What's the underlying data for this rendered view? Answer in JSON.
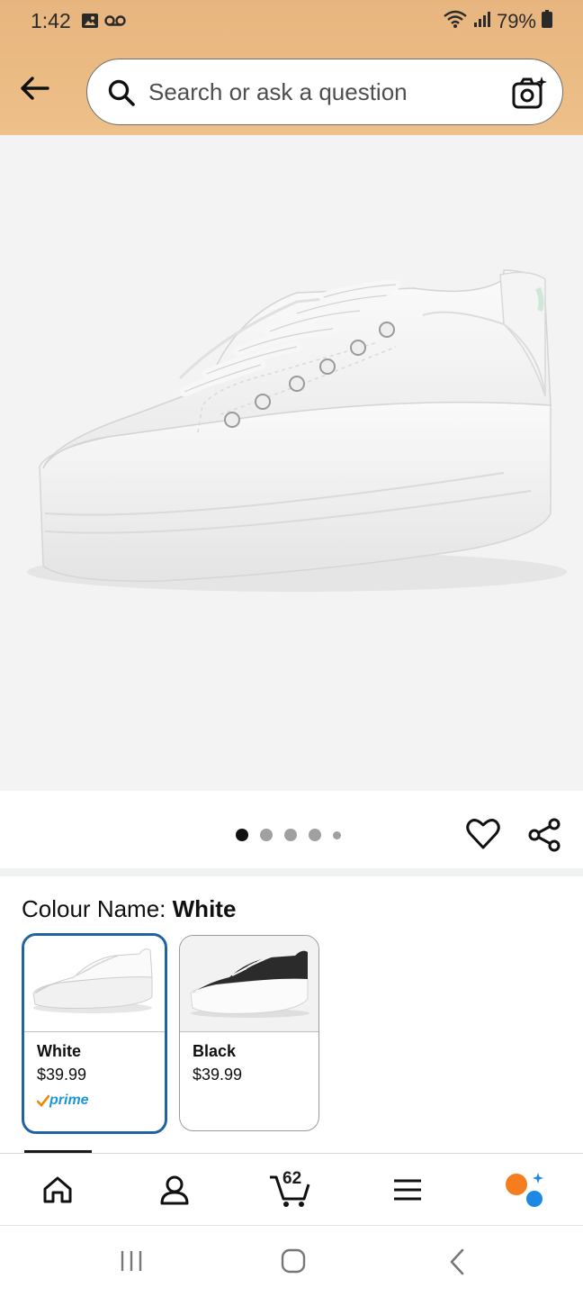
{
  "status_bar": {
    "time": "1:42",
    "battery": "79%"
  },
  "search": {
    "placeholder": "Search or ask a question"
  },
  "gallery": {
    "dot_count": 5,
    "active_index": 0
  },
  "variation": {
    "label": "Colour Name:",
    "selected": "White",
    "options": [
      {
        "name": "White",
        "price": "$39.99",
        "prime": "prime"
      },
      {
        "name": "Black",
        "price": "$39.99"
      }
    ]
  },
  "bottom_nav": {
    "cart_count": "62"
  },
  "colors": {
    "header": "#ebbb84",
    "selected_border": "#2162a1",
    "prime_blue": "#1e96d4",
    "prime_check": "#f08804"
  }
}
